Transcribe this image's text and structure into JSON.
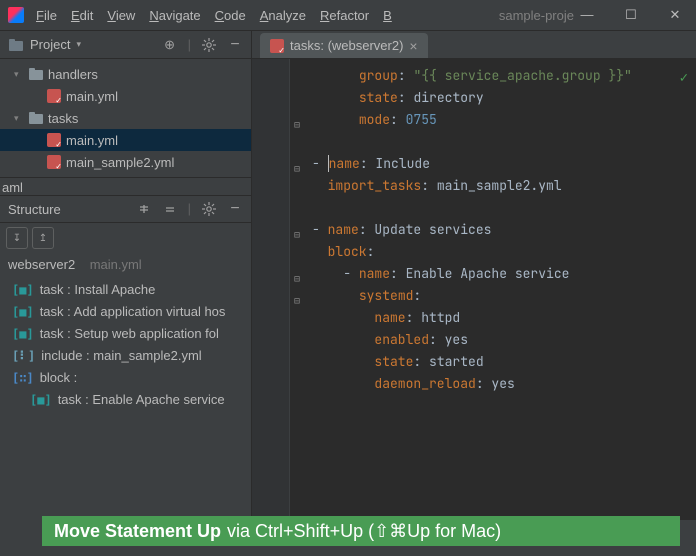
{
  "titlebar": {
    "menu": [
      "File",
      "Edit",
      "View",
      "Navigate",
      "Code",
      "Analyze",
      "Refactor",
      "B"
    ],
    "project_truncated": "sample-proje"
  },
  "window_controls": {
    "min": "—",
    "max": "☐",
    "close": "✕"
  },
  "project_panel": {
    "title": "Project",
    "tree": [
      {
        "indent": 0,
        "caret": "▾",
        "type": "folder",
        "label": "handlers"
      },
      {
        "indent": 1,
        "caret": "",
        "type": "yaml",
        "label": "main.yml"
      },
      {
        "indent": 0,
        "caret": "▾",
        "type": "folder",
        "label": "tasks"
      },
      {
        "indent": 1,
        "caret": "",
        "type": "yaml",
        "label": "main.yml",
        "selected": true
      },
      {
        "indent": 1,
        "caret": "",
        "type": "yaml",
        "label": "main_sample2.yml"
      }
    ],
    "bottom_crumb": "aml"
  },
  "structure_panel": {
    "title": "Structure",
    "breadcrumb_bold": "webserver2",
    "breadcrumb_dim": "main.yml",
    "items": [
      {
        "indent": 0,
        "icon": "task",
        "label": "task : Install Apache"
      },
      {
        "indent": 0,
        "icon": "task",
        "label": "task : Add application virtual hos"
      },
      {
        "indent": 0,
        "icon": "task",
        "label": "task : Setup web application fol"
      },
      {
        "indent": 0,
        "icon": "include",
        "label": "include : main_sample2.yml"
      },
      {
        "indent": 0,
        "icon": "block",
        "label": "block :"
      },
      {
        "indent": 1,
        "icon": "task",
        "label": "task : Enable Apache service"
      }
    ]
  },
  "editor": {
    "tab_label": "tasks: (webserver2)",
    "lines": [
      [
        [
          "",
          "      "
        ],
        [
          "key",
          "group"
        ],
        [
          "plain",
          ": "
        ],
        [
          "str",
          "\"{{ service_apache.group }}\""
        ]
      ],
      [
        [
          "",
          "      "
        ],
        [
          "key",
          "state"
        ],
        [
          "plain",
          ": "
        ],
        [
          "plain",
          "directory"
        ]
      ],
      [
        [
          "",
          "      "
        ],
        [
          "key",
          "mode"
        ],
        [
          "plain",
          ": "
        ],
        [
          "num",
          "0755"
        ]
      ],
      [],
      [
        [
          "plain",
          "- "
        ],
        [
          "caret",
          ""
        ],
        [
          "key",
          "name"
        ],
        [
          "plain",
          ": "
        ],
        [
          "plain",
          "Include"
        ]
      ],
      [
        [
          "",
          "  "
        ],
        [
          "key",
          "import_tasks"
        ],
        [
          "plain",
          ": "
        ],
        [
          "plain",
          "main_sample2.yml"
        ]
      ],
      [],
      [
        [
          "plain",
          "- "
        ],
        [
          "key",
          "name"
        ],
        [
          "plain",
          ": "
        ],
        [
          "plain",
          "Update services"
        ]
      ],
      [
        [
          "",
          "  "
        ],
        [
          "key",
          "block"
        ],
        [
          "plain",
          ":"
        ]
      ],
      [
        [
          "",
          "    "
        ],
        [
          "plain",
          "- "
        ],
        [
          "key",
          "name"
        ],
        [
          "plain",
          ": "
        ],
        [
          "plain",
          "Enable Apache service"
        ]
      ],
      [
        [
          "",
          "      "
        ],
        [
          "key",
          "systemd"
        ],
        [
          "plain",
          ":"
        ]
      ],
      [
        [
          "",
          "        "
        ],
        [
          "key",
          "name"
        ],
        [
          "plain",
          ": "
        ],
        [
          "plain",
          "httpd"
        ]
      ],
      [
        [
          "",
          "        "
        ],
        [
          "key",
          "enabled"
        ],
        [
          "plain",
          ": "
        ],
        [
          "plain",
          "yes"
        ]
      ],
      [
        [
          "",
          "        "
        ],
        [
          "key",
          "state"
        ],
        [
          "plain",
          ": "
        ],
        [
          "plain",
          "started"
        ]
      ],
      [
        [
          "",
          "        "
        ],
        [
          "key",
          "daemon_reload"
        ],
        [
          "plain",
          ": "
        ],
        [
          "plain",
          "yes"
        ]
      ]
    ],
    "fold_markers": [
      2,
      4,
      7,
      9,
      10
    ]
  },
  "hint": {
    "bold": "Move Statement Up",
    "rest": "via Ctrl+Shift+Up (⇧⌘Up for Mac)"
  }
}
